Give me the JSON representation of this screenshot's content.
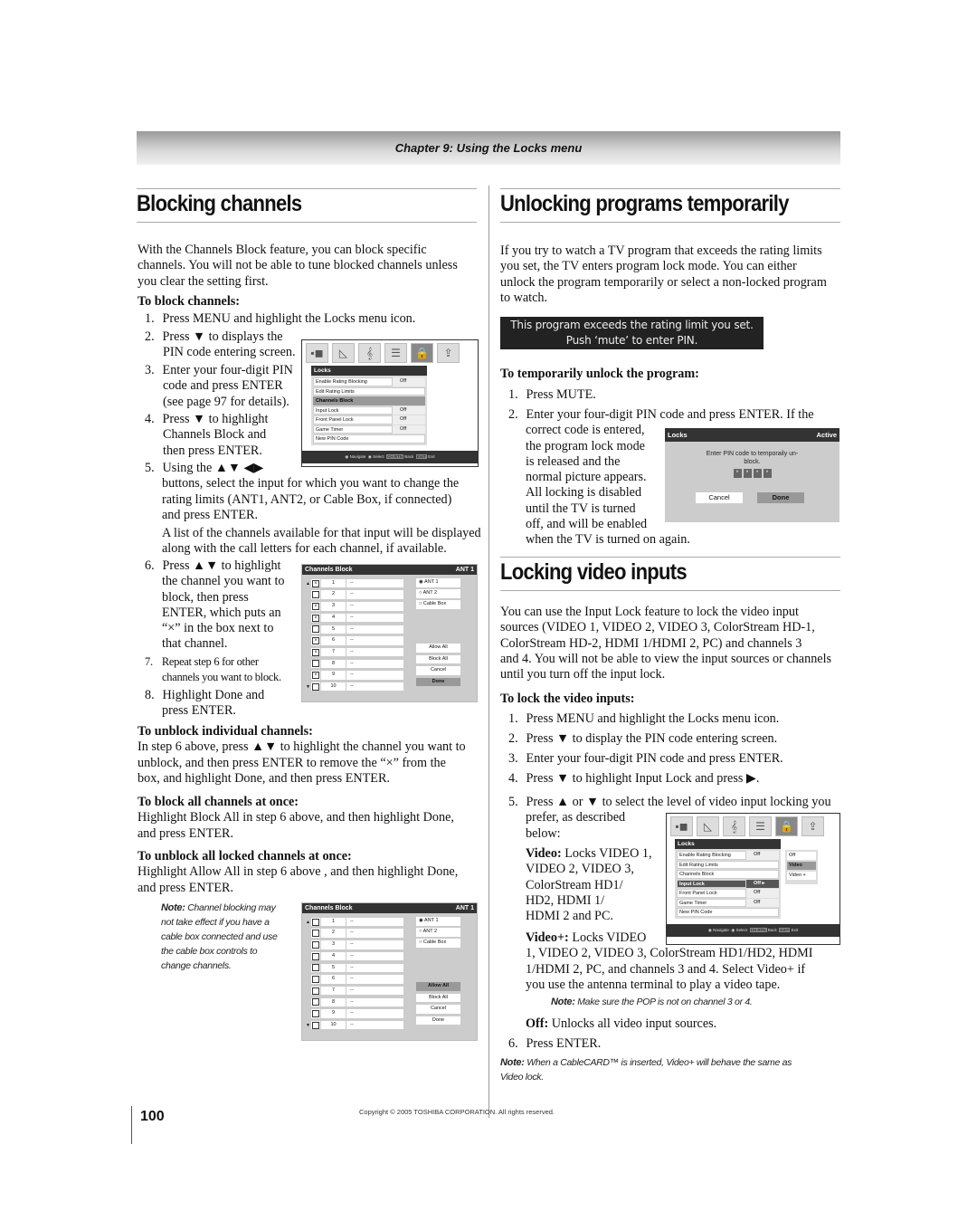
{
  "header": {
    "chapter": "Chapter 9: Using the Locks menu"
  },
  "left": {
    "title": "Blocking channels",
    "intro": [
      "With the Channels Block feature, you can block specific",
      "channels. You will not be able to tune blocked channels unless",
      "you clear the setting first."
    ],
    "block_heading": "To block channels:",
    "steps": {
      "s1": {
        "n": "1.",
        "text": "Press MENU and highlight the Locks menu icon."
      },
      "s2": {
        "n": "2.",
        "lines": [
          "Press ▼ to displays the",
          "PIN code entering screen."
        ]
      },
      "s3": {
        "n": "3.",
        "lines": [
          "Enter your four-digit PIN",
          "code and press ENTER",
          "(see page 97 for details)."
        ]
      },
      "s4": {
        "n": "4.",
        "lines": [
          "Press ▼ to highlight",
          "Channels Block and",
          "then press ENTER."
        ]
      },
      "s5": {
        "n": "5.",
        "lines": [
          "Using the ▲▼ ◀▶",
          "buttons, select the input for which you want to change the",
          "rating limits (ANT1, ANT2, or Cable  Box, if connected)",
          "and press ENTER.",
          "A list of the channels available for that input will be displayed",
          "along with the call letters for each channel, if available."
        ]
      },
      "s6": {
        "n": "6.",
        "lines": [
          "Press ▲▼ to highlight",
          "the channel you want to",
          "block, then press",
          "ENTER, which puts an",
          "“×” in the box next to",
          "that channel."
        ]
      },
      "s7": {
        "n": "7.",
        "lines": [
          "Repeat step 6 for other",
          "channels you want to block."
        ]
      },
      "s8": {
        "n": "8.",
        "lines": [
          "Highlight Done and",
          "press ENTER."
        ]
      }
    },
    "unblock_individual": {
      "heading": "To unblock individual channels:",
      "lines": [
        "In step 6 above, press ▲▼ to highlight the channel you want to",
        "unblock, and then press ENTER to remove the “×” from the",
        "box, and highlight Done, and then press ENTER."
      ]
    },
    "block_all": {
      "heading": "To block all channels at once:",
      "lines": [
        "Highlight Block All in step 6 above, and then highlight Done,",
        "and press ENTER."
      ]
    },
    "unblock_all": {
      "heading": "To unblock all locked channels at once:",
      "lines": [
        "Highlight Allow All in step 6 above , and then highlight Done,",
        "and press ENTER."
      ]
    },
    "note": {
      "label": "Note:",
      "lines": [
        " Channel blocking may",
        "not take effect if you have a",
        "cable box connected and use",
        "the cable box controls to",
        "change channels."
      ]
    }
  },
  "locks_menu_1": {
    "header": "Locks",
    "icons": [
      "setup-icon",
      "picture-icon",
      "audio-icon",
      "preferences-icon",
      "lock-icon",
      "applications-icon"
    ],
    "items": [
      {
        "label": "Enable Rating Blocking",
        "value": "Off"
      },
      {
        "label": "Edit Rating Limits",
        "value": ""
      },
      {
        "label": "Channels Block",
        "value": ""
      },
      {
        "label": "Input Lock",
        "value": "Off"
      },
      {
        "label": "Front Panel Lock",
        "value": "Off"
      },
      {
        "label": "Game Timer",
        "value": "Off"
      },
      {
        "label": "New PIN Code",
        "value": ""
      }
    ],
    "navbar": {
      "navigate": "Navigate",
      "select": "Select",
      "back_key": "CH RTN",
      "back": "Back",
      "exit_key": "EXIT",
      "exit": "Exit"
    }
  },
  "channels_block_1": {
    "title": "Channels Block",
    "input": "ANT 1",
    "channels": [
      {
        "num": "1",
        "call": "--",
        "blocked": true
      },
      {
        "num": "2",
        "call": "--",
        "blocked": false
      },
      {
        "num": "3",
        "call": "--",
        "blocked": true
      },
      {
        "num": "4",
        "call": "--",
        "blocked": true
      },
      {
        "num": "5",
        "call": "--",
        "blocked": false
      },
      {
        "num": "6",
        "call": "--",
        "blocked": true
      },
      {
        "num": "7",
        "call": "--",
        "blocked": true
      },
      {
        "num": "8",
        "call": "--",
        "blocked": false
      },
      {
        "num": "9",
        "call": "--",
        "blocked": true
      },
      {
        "num": "10",
        "call": "--",
        "blocked": false
      }
    ],
    "inputs": [
      {
        "label": "ANT 1",
        "selected": true
      },
      {
        "label": "ANT 2",
        "selected": false
      },
      {
        "label": "Cable Box",
        "selected": false
      }
    ],
    "buttons": [
      {
        "label": "Allow All",
        "highlighted": false
      },
      {
        "label": "Block All",
        "highlighted": false
      },
      {
        "label": "Cancel",
        "highlighted": false
      },
      {
        "label": "Done",
        "highlighted": true
      }
    ]
  },
  "channels_block_2": {
    "title": "Channels Block",
    "input": "ANT 1",
    "channels": [
      {
        "num": "1",
        "call": "--",
        "blocked": false
      },
      {
        "num": "2",
        "call": "--",
        "blocked": false
      },
      {
        "num": "3",
        "call": "--",
        "blocked": false
      },
      {
        "num": "4",
        "call": "--",
        "blocked": false
      },
      {
        "num": "5",
        "call": "--",
        "blocked": false
      },
      {
        "num": "6",
        "call": "--",
        "blocked": false
      },
      {
        "num": "7",
        "call": "--",
        "blocked": false
      },
      {
        "num": "8",
        "call": "--",
        "blocked": false
      },
      {
        "num": "9",
        "call": "--",
        "blocked": false
      },
      {
        "num": "10",
        "call": "--",
        "blocked": false
      }
    ],
    "inputs": [
      {
        "label": "ANT 1",
        "selected": true
      },
      {
        "label": "ANT 2",
        "selected": false
      },
      {
        "label": "Cable Box",
        "selected": false
      }
    ],
    "buttons": [
      {
        "label": "Allow All",
        "highlighted": true
      },
      {
        "label": "Block All",
        "highlighted": false
      },
      {
        "label": "Cancel",
        "highlighted": false
      },
      {
        "label": "Done",
        "highlighted": false
      }
    ]
  },
  "right": {
    "title1": "Unlocking programs temporarily",
    "intro1": [
      "If you try to watch a TV program that exceeds the rating limits",
      "you set, the TV enters program lock mode. You can either",
      "unlock the program temporarily or select a non-locked program",
      "to watch."
    ],
    "warning": [
      "This program exceeds the rating limit you set.",
      "Push ‘mute’ to enter PIN."
    ],
    "unlock_heading": "To temporarily unlock the program:",
    "u1": {
      "n": "1.",
      "text": "Press MUTE."
    },
    "u2": {
      "n": "2.",
      "lines": [
        "Enter your four-digit PIN code and press ENTER. If the",
        "correct code is entered,",
        "the program lock mode",
        "is released and the",
        "normal picture appears.",
        "All locking is disabled",
        "until the TV is turned",
        "off, and will be enabled",
        "when the TV is turned on again."
      ]
    },
    "title2": "Locking video inputs",
    "intro2": [
      "You can use the Input Lock feature to lock the video input",
      "sources (VIDEO 1, VIDEO 2, VIDEO 3, ColorStream HD-1,",
      "ColorStream HD-2, HDMI 1/HDMI 2, PC) and channels 3",
      "and 4. You will not be able to view the input sources or channels",
      "until you turn off the input lock."
    ],
    "lock_heading": "To lock the video inputs:",
    "l1": {
      "n": "1.",
      "text": "Press MENU and highlight the Locks menu icon."
    },
    "l2": {
      "n": "2.",
      "text": "Press ▼ to display the PIN code entering screen."
    },
    "l3": {
      "n": "3.",
      "text": "Enter your four-digit PIN code and press ENTER."
    },
    "l4": {
      "n": "4.",
      "text": "Press ▼ to highlight Input Lock and press ▶."
    },
    "l5": {
      "n": "5.",
      "lines": [
        "Press ▲ or ▼ to select the level of video input locking you",
        "prefer, as described",
        "below:"
      ]
    },
    "video": {
      "label": "Video:",
      "lines": [
        " Locks VIDEO 1,",
        "VIDEO 2, VIDEO 3,",
        "ColorStream HD1/",
        "HD2, HDMI 1/",
        "HDMI 2 and PC."
      ]
    },
    "videoplus": {
      "label": "Video+:",
      "lines": [
        " Locks VIDEO",
        "1, VIDEO 2, VIDEO 3, ColorStream HD1/HD2, HDMI",
        "1/HDMI 2, PC, and channels 3 and 4. Select Video+ if",
        "you use the antenna terminal to play a video tape."
      ]
    },
    "note_pop": {
      "label": "Note:",
      "text": " Make sure the POP is not on channel 3 or 4."
    },
    "off": {
      "label": "Off:",
      "text": " Unlocks all video input sources."
    },
    "l6": {
      "n": "6.",
      "text": "Press ENTER."
    },
    "note_cablecard": {
      "label": "Note:",
      "lines": [
        " When a CableCARD™ is inserted, Video+ will behave the same as",
        "Video lock."
      ]
    }
  },
  "pin_dialog": {
    "title": "Locks",
    "status": "Active",
    "message": [
      "Enter PIN code to temporaily un-",
      "block."
    ],
    "pin_mask": [
      "*",
      "*",
      "*",
      "*"
    ],
    "cancel": "Cancel",
    "done": "Done"
  },
  "locks_menu_2": {
    "header": "Locks",
    "items": [
      {
        "label": "Enable Rating Blocking",
        "value": "Off"
      },
      {
        "label": "Edit Rating Limits",
        "value": ""
      },
      {
        "label": "Channels Block",
        "value": ""
      },
      {
        "label": "Input Lock",
        "value": "Off ▸"
      },
      {
        "label": "Front Panel Lock",
        "value": "Off"
      },
      {
        "label": "Game Timer",
        "value": "Off"
      },
      {
        "label": "New PIN Code",
        "value": ""
      }
    ],
    "input_lock_options": [
      {
        "label": "Off",
        "selected": false
      },
      {
        "label": "Video",
        "selected": true
      },
      {
        "label": "Video +",
        "selected": false
      }
    ],
    "navbar": {
      "navigate": "Navigate",
      "select": "Select",
      "back_key": "CH RTN",
      "back": "Back",
      "exit_key": "EXIT",
      "exit": "Exit"
    }
  },
  "footer": {
    "page_number": "100",
    "copyright": "Copyright © 2005 TOSHIBA CORPORATION. All rights reserved."
  }
}
